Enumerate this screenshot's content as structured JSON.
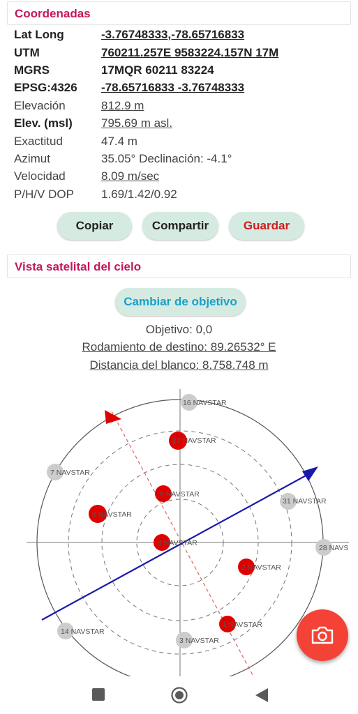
{
  "coords": {
    "header": "Coordenadas",
    "rows": [
      {
        "label": "Lat Long",
        "value": "-3.76748333,-78.65716833"
      },
      {
        "label": "UTM",
        "value": "760211.257E 9583224.157N 17M"
      },
      {
        "label": "MGRS",
        "value": "17MQR 60211 83224"
      },
      {
        "label": "EPSG:4326",
        "value": "-78.65716833 -3.76748333"
      },
      {
        "label": "Elevación",
        "value": "812.9 m"
      },
      {
        "label": "Elev. (msl)",
        "value": "795.69 m asl."
      },
      {
        "label": "Exactitud",
        "value": "47.4 m"
      },
      {
        "label": "Azimut",
        "value": "35.05° Declinación: -4.1°"
      },
      {
        "label": "Velocidad",
        "value": "8.09 m/sec"
      },
      {
        "label": "P/H/V DOP",
        "value": "1.69/1.42/0.92"
      }
    ]
  },
  "buttons": {
    "copy": "Copiar",
    "share": "Compartir",
    "save": "Guardar"
  },
  "sky": {
    "header": "Vista satelital del cielo",
    "change_target": "Cambiar de objetivo",
    "target": "Objetivo: 0,0",
    "bearing": "Rodamiento de destino: 89.26532° E",
    "distance": "Distancia del blanco: 8.758.748 m",
    "satellites": [
      {
        "id": "16",
        "label": "16 NAVSTAR",
        "color": "#cccccc"
      },
      {
        "id": "27",
        "label": "27 NAVSTAR",
        "color": "#e00000"
      },
      {
        "id": "7",
        "label": "7 NAVSTAR",
        "color": "#cccccc"
      },
      {
        "id": "8",
        "label": "8 NAVSTAR",
        "color": "#e00000"
      },
      {
        "id": "31",
        "label": "31 NAVSTAR",
        "color": "#cccccc"
      },
      {
        "id": "9",
        "label": "9 NAVSTAR",
        "color": "#e00000"
      },
      {
        "id": "4",
        "label": "4 NAVSTAR",
        "color": "#e00000"
      },
      {
        "id": "28",
        "label": "28 NAVS",
        "color": "#cccccc"
      },
      {
        "id": "2",
        "label": "2 NAVSTAR",
        "color": "#e00000"
      },
      {
        "id": "1",
        "label": "1 NAVSTAR",
        "color": "#e00000"
      },
      {
        "id": "14",
        "label": "14 NAVSTAR",
        "color": "#cccccc"
      },
      {
        "id": "3",
        "label": "3 NAVSTAR",
        "color": "#cccccc"
      }
    ],
    "colors": {
      "heading": "#1a1aaa",
      "target": "#e00000",
      "grid": "#555555"
    }
  },
  "icons": {
    "fab": "camera-icon",
    "nav": [
      "recents-square-icon",
      "home-circle-icon",
      "back-triangle-icon"
    ]
  }
}
